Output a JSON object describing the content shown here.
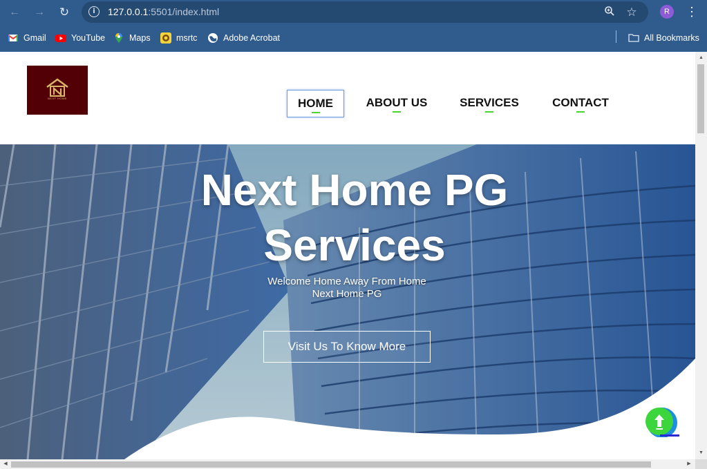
{
  "browser": {
    "url_host": "127.0.0.1",
    "url_path": ":5501/index.html",
    "avatar_initial": "R",
    "bookmarks": [
      {
        "label": "Gmail",
        "icon": "gmail-icon"
      },
      {
        "label": "YouTube",
        "icon": "youtube-icon"
      },
      {
        "label": "Maps",
        "icon": "maps-icon"
      },
      {
        "label": "msrtc",
        "icon": "msrtc-icon"
      },
      {
        "label": "Adobe Acrobat",
        "icon": "globe-icon"
      }
    ],
    "all_bookmarks_label": "All Bookmarks"
  },
  "site": {
    "logo_tagline": "NEXT HOME",
    "menu": [
      {
        "label": "HOME",
        "active": true
      },
      {
        "label": "ABOUT US",
        "active": false
      },
      {
        "label": "SERVICES",
        "active": false
      },
      {
        "label": "CONTACT",
        "active": false
      }
    ]
  },
  "hero": {
    "title_line1": "Next Home PG",
    "title_line2": "Services",
    "subtitle_line1": "Welcome Home Away From Home",
    "subtitle_line2": "Next Home PG",
    "cta_label": "Visit Us To Know More"
  },
  "colors": {
    "chrome": "#2f5c8d",
    "logo_bg": "#520006",
    "accent_green": "#44d62c",
    "scroll_button": "#3cd63c"
  }
}
